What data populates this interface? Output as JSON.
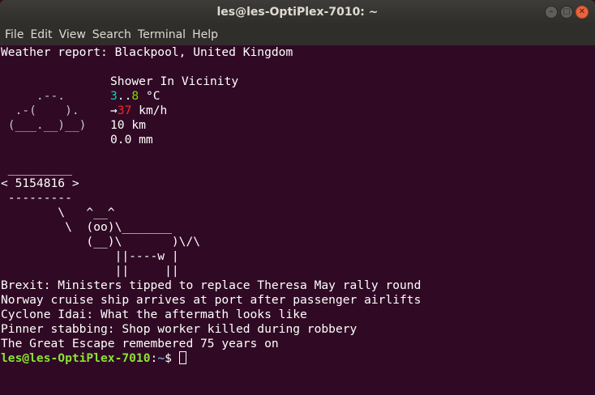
{
  "window": {
    "title": "les@les-OptiPlex-7010: ~"
  },
  "menu": [
    "File",
    "Edit",
    "View",
    "Search",
    "Terminal",
    "Help"
  ],
  "weather": {
    "header": "Weather report: Blackpool, United Kingdom",
    "cloud_art": [
      "",
      "     .--.    ",
      "  .-(    ).  ",
      " (___.__)__) "
    ],
    "condition": "Shower In Vicinity",
    "temp_low": "3",
    "temp_sep": "..",
    "temp_high": "8",
    "temp_unit": " °C",
    "wind_arrow": "→",
    "wind_speed": "37",
    "wind_unit": " km/h",
    "visibility": "10 km",
    "precip": "0.0 mm"
  },
  "cowsay": [
    " _________",
    "< 5154816 >",
    " ---------",
    "        \\   ^__^",
    "         \\  (oo)\\_______",
    "            (__)\\       )\\/\\",
    "                ||----w |",
    "                ||     ||"
  ],
  "headlines": [
    "Brexit: Ministers tipped to replace Theresa May rally round",
    "Norway cruise ship arrives at port after passenger airlifts",
    "Cyclone Idai: What the aftermath looks like",
    "Pinner stabbing: Shop worker killed during robbery",
    "The Great Escape remembered 75 years on"
  ],
  "prompt": {
    "user_host": "les@les-OptiPlex-7010",
    "path_sep": ":",
    "path": "~",
    "symbol": "$ "
  }
}
